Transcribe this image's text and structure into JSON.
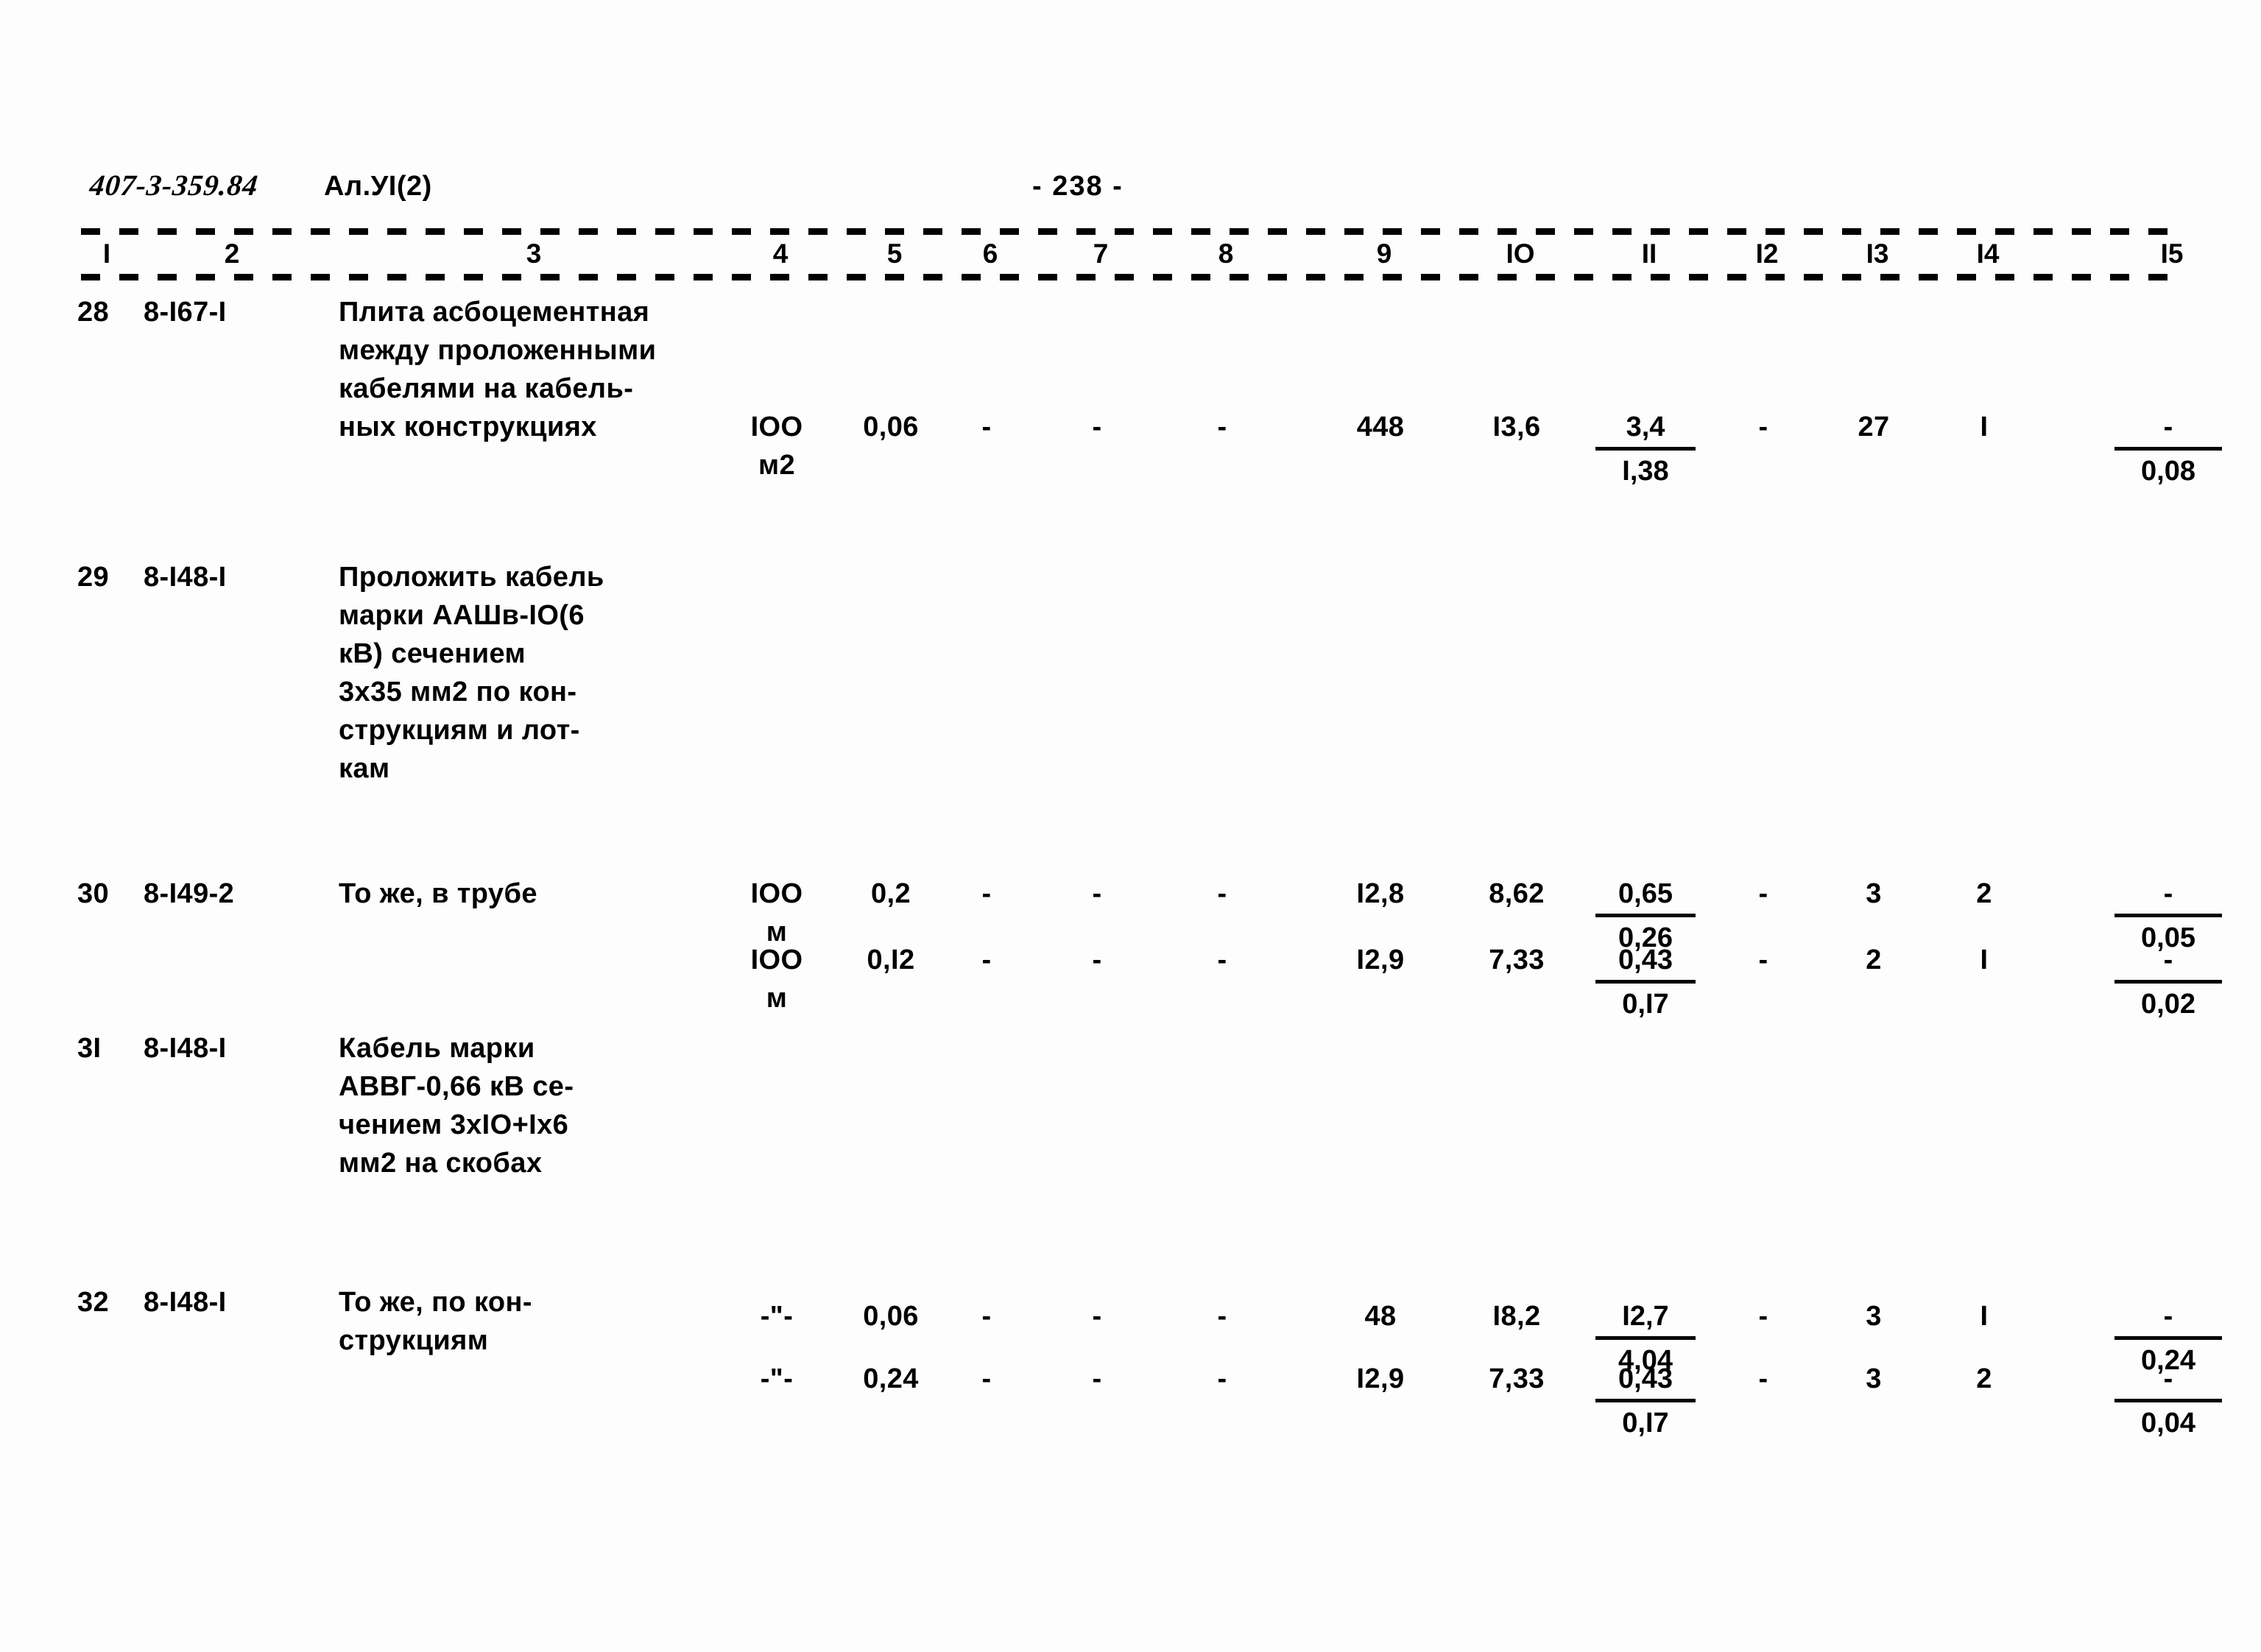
{
  "header": {
    "doc_code": "407-3-359.84",
    "album_ref": "Ал.УI(2)",
    "page_number": "- 238 -"
  },
  "table": {
    "column_numbers": [
      "I",
      "2",
      "3",
      "4",
      "5",
      "6",
      "7",
      "8",
      "9",
      "IO",
      "II",
      "I2",
      "I3",
      "I4",
      "I5"
    ],
    "rows": [
      {
        "num": "28",
        "code": "8-I67-I",
        "description": [
          "Плита асбоцементная",
          "между проложенными",
          "кабелями на кабель-",
          "ных конструкциях"
        ],
        "unit": [
          "IOO",
          "м2"
        ],
        "c5": "0,06",
        "c6": "-",
        "c7": "-",
        "c8": "-",
        "c9": "448",
        "c10": "I3,6",
        "c11_num": "3,4",
        "c11_den": "I,38",
        "c12": "-",
        "c13": "27",
        "c14": "I",
        "c15_num": "-",
        "c15_den": "0,08"
      },
      {
        "num": "29",
        "code": "8-I48-I",
        "description": [
          "Проложить кабель",
          "марки ААШв-IO(6",
          "кВ) сечением",
          "3х35 мм2 по кон-",
          "струкциям и лот-",
          "кам"
        ],
        "unit": [
          "IOO",
          "м"
        ],
        "c5": "0,I2",
        "c6": "-",
        "c7": "-",
        "c8": "-",
        "c9": "I2,9",
        "c10": "7,33",
        "c11_num": "0,43",
        "c11_den": "0,I7",
        "c12": "-",
        "c13": "2",
        "c14": "I",
        "c15_num": "-",
        "c15_den": "0,02"
      },
      {
        "num": "30",
        "code": "8-I49-2",
        "description": [
          "То же, в трубе"
        ],
        "unit": [
          "IOO",
          "м"
        ],
        "c5": "0,2",
        "c6": "-",
        "c7": "-",
        "c8": "-",
        "c9": "I2,8",
        "c10": "8,62",
        "c11_num": "0,65",
        "c11_den": "0,26",
        "c12": "-",
        "c13": "3",
        "c14": "2",
        "c15_num": "-",
        "c15_den": "0,05"
      },
      {
        "num": "3I",
        "code": "8-I48-I",
        "description": [
          "Кабель марки",
          "АВВГ-0,66 кВ се-",
          "чением 3хIO+Iх6",
          "мм2 на скобах"
        ],
        "unit": [
          "-\"-",
          ""
        ],
        "c5": "0,06",
        "c6": "-",
        "c7": "-",
        "c8": "-",
        "c9": "48",
        "c10": "I8,2",
        "c11_num": "I2,7",
        "c11_den": "4,04",
        "c12": "-",
        "c13": "3",
        "c14": "I",
        "c15_num": "-",
        "c15_den": "0,24"
      },
      {
        "num": "32",
        "code": "8-I48-I",
        "description": [
          "То же, по кон-",
          "струкциям"
        ],
        "unit": [
          "-\"-",
          ""
        ],
        "c5": "0,24",
        "c6": "-",
        "c7": "-",
        "c8": "-",
        "c9": "I2,9",
        "c10": "7,33",
        "c11_num": "0,43",
        "c11_den": "0,I7",
        "c12": "-",
        "c13": "3",
        "c14": "2",
        "c15_num": "-",
        "c15_den": "0,04"
      }
    ]
  },
  "layout": {
    "column_x": [
      105,
      195,
      460,
      1000,
      1135,
      1300,
      1450,
      1620,
      1810,
      1990,
      2160,
      2355,
      2500,
      2650,
      2865
    ],
    "column_w": [
      70,
      230,
      520,
      110,
      150,
      80,
      80,
      80,
      130,
      140,
      150,
      80,
      90,
      90,
      160
    ],
    "row_tops": [
      0,
      360,
      790,
      1000,
      1345
    ],
    "value_line_offsets": [
      156,
      520,
      0,
      364,
      104
    ]
  },
  "colors": {
    "ink": "#000000",
    "paper": "#fdfdfd"
  }
}
